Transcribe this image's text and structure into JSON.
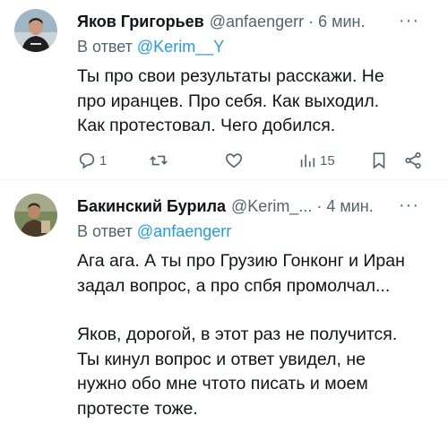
{
  "tweets": [
    {
      "author_name": "Яков Григорьев",
      "handle": "@anfaengerr",
      "separator": "·",
      "time": "6 мин.",
      "more": "···",
      "reply_prefix": "В ответ",
      "reply_to": "@Kerim__Y",
      "lines": [
        "Ты про свои результаты расскажи. Не",
        "про иранцев. Про себя. Как выходил.",
        "Как протестовал. Чего добился."
      ],
      "actions": {
        "reply_count": "1",
        "retweet_count": "",
        "like_count": "",
        "views_count": "15"
      }
    },
    {
      "author_name": "Бакинский Бурила",
      "handle": "@Kerim_...",
      "separator": "·",
      "time": "4 мин.",
      "more": "···",
      "reply_prefix": "В ответ",
      "reply_to": "@anfaengerr",
      "paragraph1": [
        "Ага ага. А ты про Грузию Гонконг и Иран",
        "задал вопрос, а про спбя промолчал..."
      ],
      "paragraph2": [
        "Яков, дорогой, в этот раз не получится.",
        "Ты кинул вопрос и ответ увидел, не",
        "нужно обо мне чтото писать и моем",
        "протесте тоже."
      ]
    }
  ],
  "icons": {
    "reply": "speech-bubble-icon",
    "retweet": "retweet-arrows-icon",
    "like": "heart-icon",
    "views": "bar-chart-icon",
    "bookmark": "bookmark-icon",
    "share": "share-icon"
  },
  "colors": {
    "link": "#1d9bf0",
    "secondary": "#536471",
    "text": "#0f1419"
  }
}
